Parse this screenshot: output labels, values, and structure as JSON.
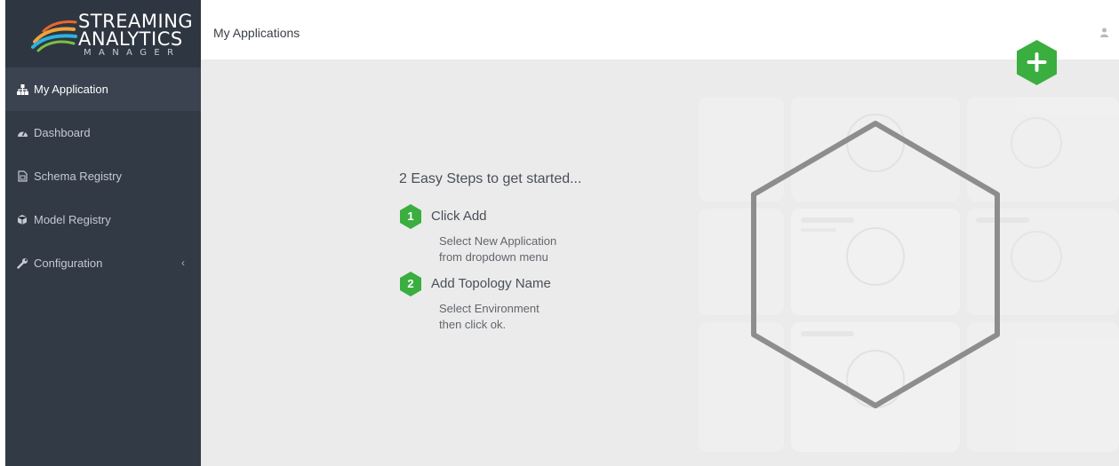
{
  "brand": {
    "line1": "STREAMING",
    "line2": "ANALYTICS",
    "line3": "MANAGER"
  },
  "sidebar": {
    "items": [
      {
        "label": "My Application",
        "icon": "sitemap-icon",
        "active": true
      },
      {
        "label": "Dashboard",
        "icon": "dashboard-icon",
        "active": false
      },
      {
        "label": "Schema Registry",
        "icon": "file-icon",
        "active": false
      },
      {
        "label": "Model Registry",
        "icon": "cube-icon",
        "active": false
      },
      {
        "label": "Configuration",
        "icon": "wrench-icon",
        "active": false,
        "chevron": "‹"
      }
    ]
  },
  "header": {
    "title": "My Applications",
    "user_icon": "user-icon"
  },
  "main": {
    "steps_title": "2 Easy Steps to get started...",
    "steps": [
      {
        "number": "1",
        "title": "Click Add",
        "desc_line1": "Select New Application",
        "desc_line2": "from dropdown menu"
      },
      {
        "number": "2",
        "title": "Add Topology Name",
        "desc_line1": "Select Environment",
        "desc_line2": "then click ok."
      }
    ],
    "add_button_icon": "plus-icon"
  },
  "colors": {
    "sidebar_bg": "#323a45",
    "accent_green": "#3aae3f",
    "main_bg": "#ebebeb"
  }
}
